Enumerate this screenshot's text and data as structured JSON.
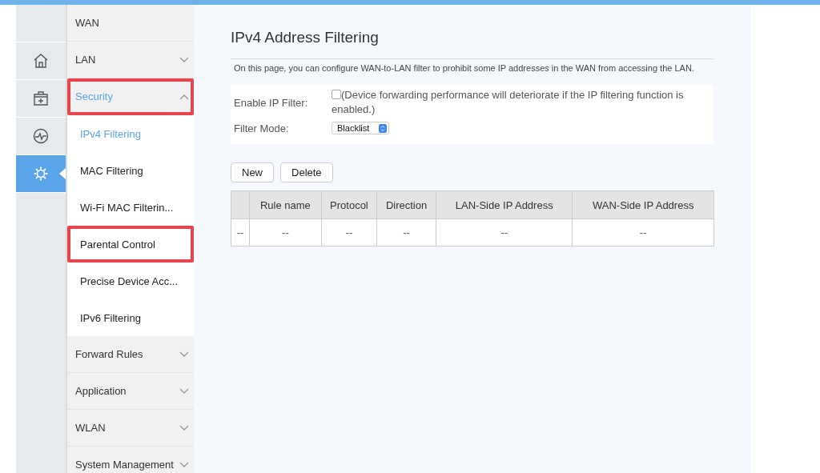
{
  "icon_rail": [
    {
      "kind": "blank",
      "selected": false
    },
    {
      "kind": "home",
      "selected": false
    },
    {
      "kind": "medkit",
      "selected": false
    },
    {
      "kind": "pulse",
      "selected": false
    },
    {
      "kind": "gear",
      "selected": true
    }
  ],
  "sidebar": {
    "items": [
      {
        "label": "WAN",
        "kind": "link",
        "highlighted": false,
        "selected": false
      },
      {
        "label": "LAN",
        "kind": "group",
        "expanded": false,
        "highlighted": false,
        "selected": false
      },
      {
        "label": "Security",
        "kind": "group",
        "expanded": true,
        "highlighted": true,
        "selected": true,
        "children": [
          {
            "label": "IPv4 Filtering",
            "selected": true,
            "highlighted": false
          },
          {
            "label": "MAC Filtering",
            "selected": false,
            "highlighted": false
          },
          {
            "label": "Wi-Fi MAC Filterin...",
            "selected": false,
            "highlighted": false
          },
          {
            "label": "Parental Control",
            "selected": false,
            "highlighted": true
          },
          {
            "label": "Precise Device Acc...",
            "selected": false,
            "highlighted": false
          },
          {
            "label": "IPv6 Filtering",
            "selected": false,
            "highlighted": false
          }
        ]
      },
      {
        "label": "Forward Rules",
        "kind": "group",
        "expanded": false,
        "highlighted": false,
        "selected": false
      },
      {
        "label": "Application",
        "kind": "group",
        "expanded": false,
        "highlighted": false,
        "selected": false
      },
      {
        "label": "WLAN",
        "kind": "group",
        "expanded": false,
        "highlighted": false,
        "selected": false
      },
      {
        "label": "System Management",
        "kind": "group",
        "expanded": false,
        "highlighted": false,
        "selected": false
      }
    ]
  },
  "page": {
    "title": "IPv4 Address Filtering",
    "description": "On this page, you can configure WAN-to-LAN filter to prohibit some IP addresses in the WAN from accessing the LAN."
  },
  "form": {
    "enable_label": "Enable IP Filter:",
    "enable_checked": false,
    "enable_note": "(Device forwarding performance will deteriorate if the IP filtering function is enabled.)",
    "mode_label": "Filter Mode:",
    "mode_value": "Blacklist"
  },
  "buttons": [
    "New",
    "Delete"
  ],
  "table": {
    "columns": [
      "",
      "Rule name",
      "Protocol",
      "Direction",
      "LAN-Side IP Address",
      "WAN-Side IP Address"
    ],
    "rows": [
      [
        "--",
        "--",
        "--",
        "--",
        "--",
        "--"
      ]
    ]
  }
}
